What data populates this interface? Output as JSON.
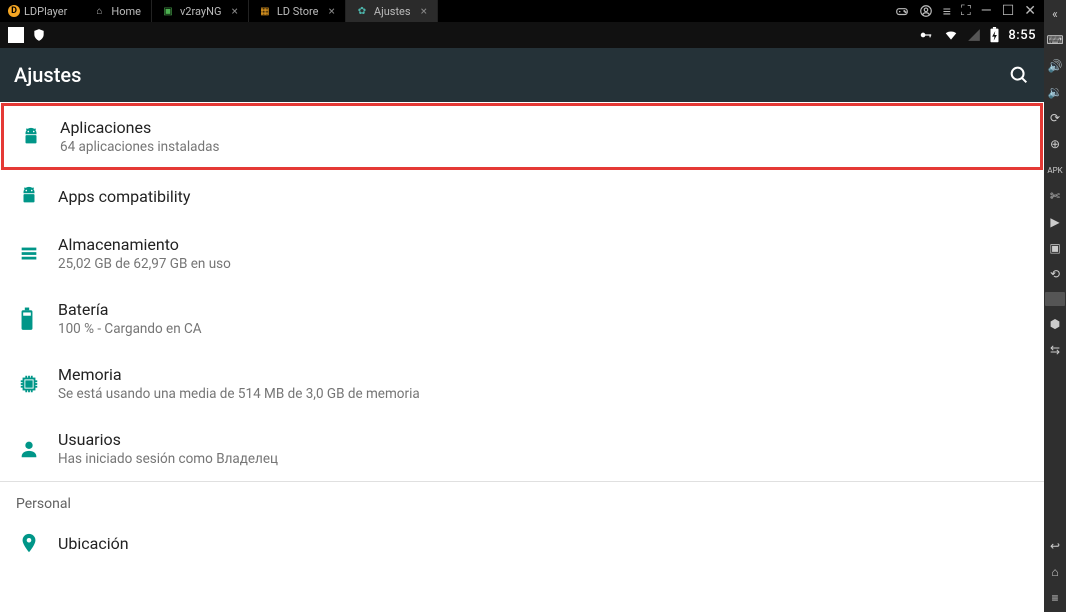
{
  "topbar": {
    "brand": "LDPlayer",
    "tabs": [
      {
        "label": "Home",
        "icon": "home",
        "active": false,
        "closable": false
      },
      {
        "label": "v2rayNG",
        "icon": "app",
        "active": false,
        "closable": true
      },
      {
        "label": "LD Store",
        "icon": "store",
        "active": false,
        "closable": true
      },
      {
        "label": "Ajustes",
        "icon": "settings",
        "active": true,
        "closable": true
      }
    ]
  },
  "statusbar": {
    "time": "8:55",
    "icons": [
      "key",
      "wifi",
      "signal-off",
      "battery-charging"
    ]
  },
  "header": {
    "title": "Ajustes"
  },
  "settings": [
    {
      "icon": "android",
      "title": "Aplicaciones",
      "sub": "64 aplicaciones instaladas",
      "highlight": true
    },
    {
      "icon": "android",
      "title": "Apps compatibility",
      "sub": ""
    },
    {
      "icon": "storage",
      "title": "Almacenamiento",
      "sub": "25,02 GB de 62,97 GB en uso"
    },
    {
      "icon": "battery",
      "title": "Batería",
      "sub": "100 % - Cargando en CA"
    },
    {
      "icon": "memory",
      "title": "Memoria",
      "sub": "Se está usando una media de 514 MB de 3,0 GB de memoria"
    },
    {
      "icon": "user",
      "title": "Usuarios",
      "sub": "Has iniciado sesión como Владелец"
    }
  ],
  "section_personal": "Personal",
  "settings_personal": [
    {
      "icon": "location",
      "title": "Ubicación",
      "sub": ""
    }
  ],
  "sidebar_icons": [
    "collapse",
    "keyboard",
    "vol-up",
    "vol-down",
    "refresh",
    "add",
    "apk",
    "cut",
    "record",
    "screenshot",
    "rotate",
    "folder",
    "pin",
    "sync"
  ],
  "sidebar_bottom": [
    "back",
    "home-nav",
    "recents"
  ]
}
